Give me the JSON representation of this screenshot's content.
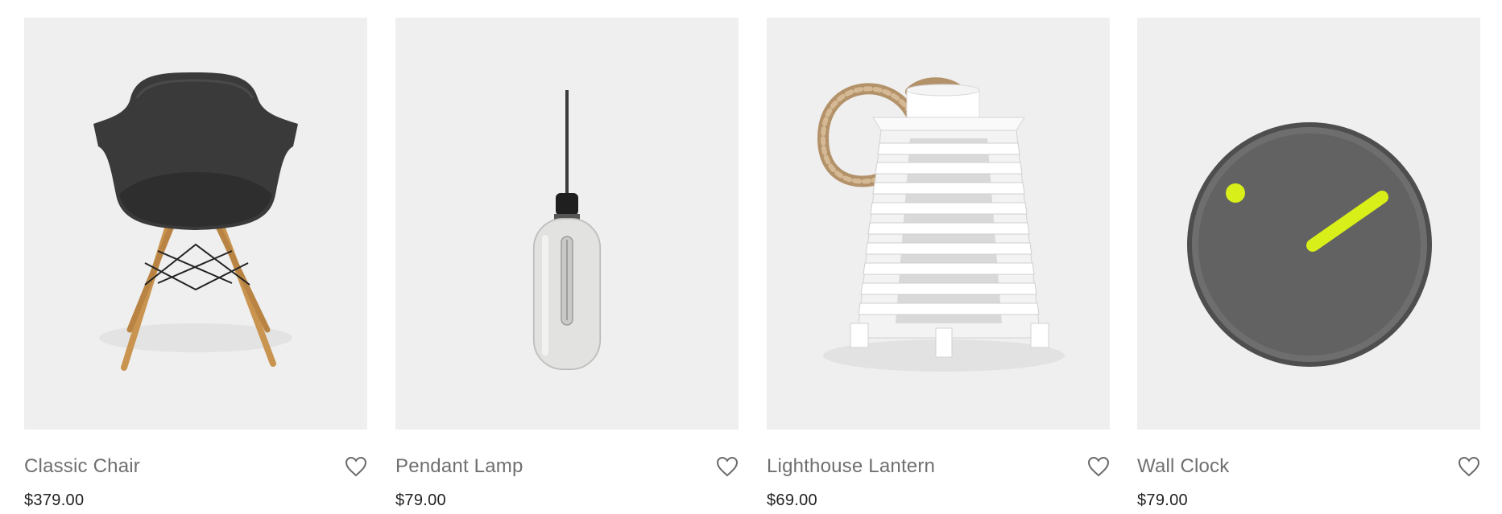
{
  "products": [
    {
      "name": "Classic Chair",
      "price": "$379.00",
      "image_icon": "chair-icon",
      "wishlist_icon": "heart-icon"
    },
    {
      "name": "Pendant Lamp",
      "price": "$79.00",
      "image_icon": "pendant-lamp-icon",
      "wishlist_icon": "heart-icon"
    },
    {
      "name": "Lighthouse Lantern",
      "price": "$69.00",
      "image_icon": "lantern-icon",
      "wishlist_icon": "heart-icon"
    },
    {
      "name": "Wall Clock",
      "price": "$79.00",
      "image_icon": "clock-icon",
      "wishlist_icon": "heart-icon"
    }
  ],
  "colors": {
    "image_background": "#efefef",
    "name_text": "#6f6f6f",
    "price_text": "#222222",
    "clock_accent": "#d8ef1a"
  }
}
